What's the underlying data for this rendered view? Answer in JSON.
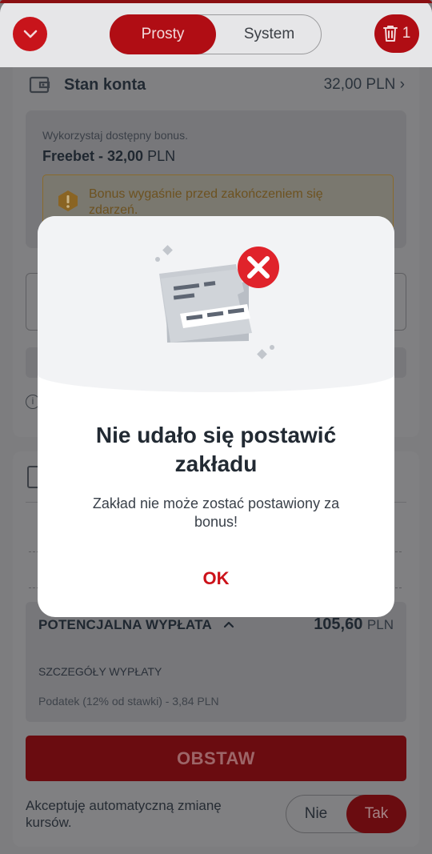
{
  "header": {
    "tabs": [
      {
        "label": "Prosty",
        "active": true
      },
      {
        "label": "System",
        "active": false
      }
    ],
    "betslip_count": "1",
    "collapse_icon": "chevron-down-icon",
    "delete_icon": "trash-icon"
  },
  "balance": {
    "label": "Stan konta",
    "value": "32,00 PLN",
    "icon": "wallet-icon"
  },
  "bonus": {
    "hint": "Wykorzystaj dostępny bonus.",
    "name_bold": "Freebet - 32,00",
    "name_unit": "PLN",
    "warning": "Bonus wygaśnie przed zakończeniem się zdarzeń.",
    "warning_icon": "warning-icon"
  },
  "payout": {
    "label": "POTENCJALNA WYPŁATA",
    "value": "105,60",
    "unit": "PLN",
    "details_title": "SZCZEGÓŁY WYPŁATY",
    "tax": "Podatek (12% od stawki) - 3,84 PLN"
  },
  "actions": {
    "place_bet": "OBSTAW",
    "accept_odds_text": "Akceptuję automatyczną zmianę kursów.",
    "toggle_no": "Nie",
    "toggle_yes": "Tak",
    "toggle_selected": "Tak"
  },
  "modal": {
    "title": "Nie udało się postawić zakładu",
    "message": "Zakład nie może zostać postawiony za bonus!",
    "ok_label": "OK",
    "illustration": "failed-ticket-icon"
  },
  "colors": {
    "brand_red": "#c8141b",
    "error_red": "#e0232b",
    "ok_text": "#cc1119",
    "overlay": "#7d7d7f"
  }
}
